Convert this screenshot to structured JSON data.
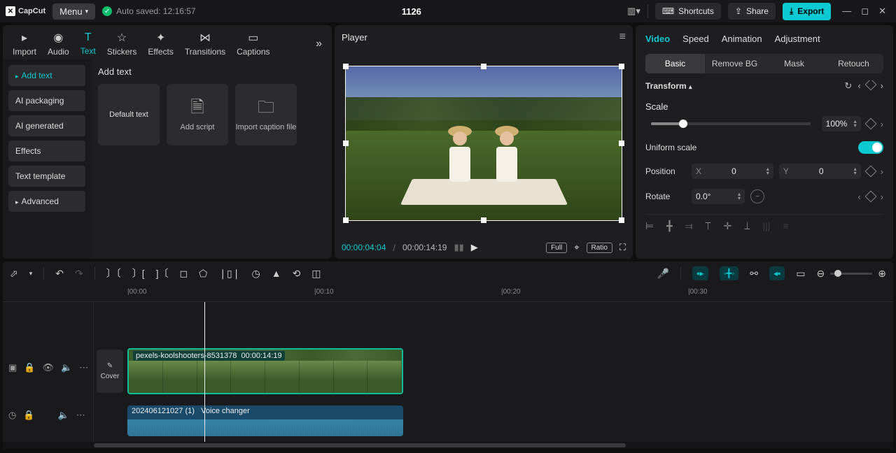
{
  "app": {
    "name": "CapCut",
    "menu": "Menu",
    "autosave": "Auto saved: 12:16:57",
    "title": "1126"
  },
  "titlebar": {
    "shortcuts": "Shortcuts",
    "share": "Share",
    "export": "Export"
  },
  "leftTabs": {
    "import": "Import",
    "audio": "Audio",
    "text": "Text",
    "stickers": "Stickers",
    "effects": "Effects",
    "transitions": "Transitions",
    "captions": "Captions"
  },
  "subnav": {
    "addText": "Add text",
    "aiPackaging": "AI packaging",
    "aiGenerated": "AI generated",
    "effects": "Effects",
    "textTemplate": "Text template",
    "advanced": "Advanced"
  },
  "addArea": {
    "heading": "Add text",
    "defaultText": "Default text",
    "addScript": "Add script",
    "importCaption": "Import caption file"
  },
  "player": {
    "title": "Player",
    "current": "00:00:04:04",
    "total": "00:00:14:19",
    "full": "Full",
    "ratio": "Ratio"
  },
  "rtabs": {
    "video": "Video",
    "speed": "Speed",
    "animation": "Animation",
    "adjustment": "Adjustment"
  },
  "seg": {
    "basic": "Basic",
    "removeBg": "Remove BG",
    "mask": "Mask",
    "retouch": "Retouch"
  },
  "props": {
    "transform": "Transform",
    "scale": "Scale",
    "scaleVal": "100%",
    "uniform": "Uniform scale",
    "position": "Position",
    "x": "X",
    "xval": "0",
    "y": "Y",
    "yval": "0",
    "rotate": "Rotate",
    "rotVal": "0.0°"
  },
  "ruler": {
    "t0": "|00:00",
    "t10": "|00:10",
    "t20": "|00:20",
    "t30": "|00:30"
  },
  "clips": {
    "videoName": "pexels-koolshooters-8531378",
    "videoDur": "00:00:14:19",
    "audioName": "202406121027 (1)",
    "audioEffect": "Voice changer"
  },
  "cover": "Cover"
}
